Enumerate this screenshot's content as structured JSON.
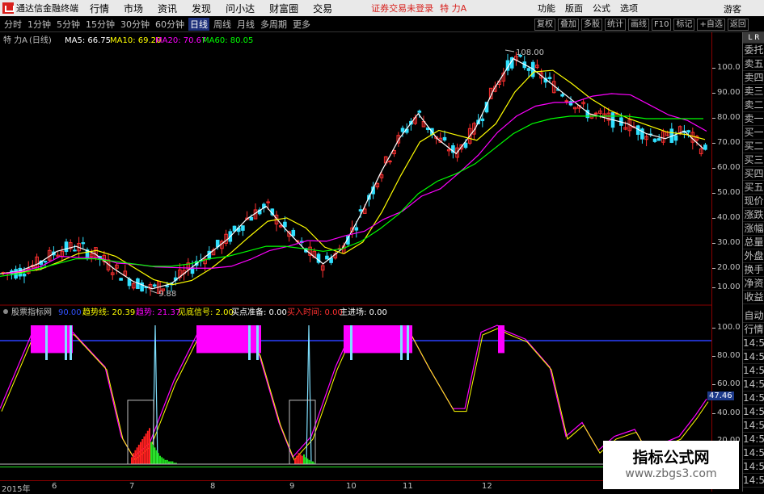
{
  "app": {
    "title": "通达信金融终端",
    "login_warning": "证券交易未登录",
    "stock_name": "特 力A"
  },
  "menu": [
    "行情",
    "市场",
    "资讯",
    "发现",
    "问小达",
    "财富圈",
    "交易"
  ],
  "right_menu": [
    "功能",
    "版面",
    "公式",
    "选项"
  ],
  "guest": "游客",
  "periods": [
    "分时",
    "1分钟",
    "5分钟",
    "15分钟",
    "30分钟",
    "60分钟",
    "日线",
    "周线",
    "月线",
    "多周期",
    "更多"
  ],
  "active_period": "日线",
  "toolbar_right": [
    "复权",
    "叠加",
    "多股",
    "统计",
    "画线",
    "F10",
    "标记",
    "+自选",
    "返回"
  ],
  "main": {
    "stock": "特 力A",
    "period_tag": "(日线)",
    "ma": [
      {
        "label": "MA5: 66.75",
        "color": "#ffffff"
      },
      {
        "label": "MA10: 69.20",
        "color": "#ffff00"
      },
      {
        "label": "MA20: 70.67",
        "color": "#ff00ff"
      },
      {
        "label": "MA60: 80.05",
        "color": "#00ff00"
      }
    ],
    "high_mark": "108.00",
    "low_mark": "9.88",
    "yticks": [
      "100.0",
      "90.00",
      "80.00",
      "70.00",
      "60.00",
      "50.00",
      "40.00",
      "30.00",
      "20.00",
      "10.00"
    ]
  },
  "indicator": {
    "name": "股票指标网",
    "fields": [
      {
        "label": "90.00",
        "color": "#3050ff"
      },
      {
        "label": "趋势线: 20.39",
        "color": "#ffff00"
      },
      {
        "label": "趋势: 21.37",
        "color": "#ff00ff"
      },
      {
        "label": "见底信号: 2.00",
        "color": "#ffff00"
      },
      {
        "label": "买点准备: 0.00",
        "color": "#ffffff"
      },
      {
        "label": "买入时间: 0.00",
        "color": "#ff3030"
      },
      {
        "label": "主进场: 0.00",
        "color": "#ffffff"
      }
    ],
    "yticks": [
      "100.0",
      "80.00",
      "60.00",
      "40.00",
      "20.00"
    ],
    "current_value": "47.46"
  },
  "sidebar": {
    "top": "L R",
    "tabs": [
      "委托",
      "卖五",
      "卖四",
      "卖三",
      "卖二",
      "卖一",
      "买一",
      "买二",
      "买三",
      "买四",
      "买五",
      "现价",
      "涨跌",
      "涨幅",
      "总量",
      "外盘",
      "换手",
      "净资",
      "收益"
    ],
    "tabs2": [
      "自动",
      "行情",
      "14:5",
      "14:5",
      "14:5",
      "14:5",
      "14:5",
      "14:5",
      "14:5",
      "14:5",
      "14:5",
      "14:5",
      "14:5"
    ]
  },
  "dates": [
    "2015年",
    "6",
    "7",
    "8",
    "9",
    "10",
    "11",
    "12"
  ],
  "watermark": {
    "title": "指标公式网",
    "url": "www.zbgs3.com"
  },
  "chart_data": {
    "type": "line",
    "title": "",
    "y_axis_range": [
      10,
      110
    ],
    "series": [
      {
        "name": "MA5",
        "values": [
          18,
          19,
          22,
          27,
          29,
          26,
          20,
          15,
          12,
          14,
          20,
          26,
          32,
          40,
          45,
          36,
          28,
          22,
          28,
          42,
          58,
          72,
          82,
          72,
          66,
          76,
          92,
          104,
          100,
          94,
          88,
          82,
          80,
          78,
          74,
          72,
          75,
          68
        ]
      },
      {
        "name": "MA60",
        "values": [
          17,
          18,
          20,
          22,
          24,
          24,
          23,
          22,
          21,
          21,
          22,
          24,
          25,
          27,
          29,
          29,
          28,
          27,
          28,
          31,
          36,
          42,
          50,
          55,
          58,
          62,
          68,
          74,
          78,
          80,
          81,
          81,
          81,
          81,
          80,
          80,
          80,
          80
        ]
      }
    ]
  }
}
